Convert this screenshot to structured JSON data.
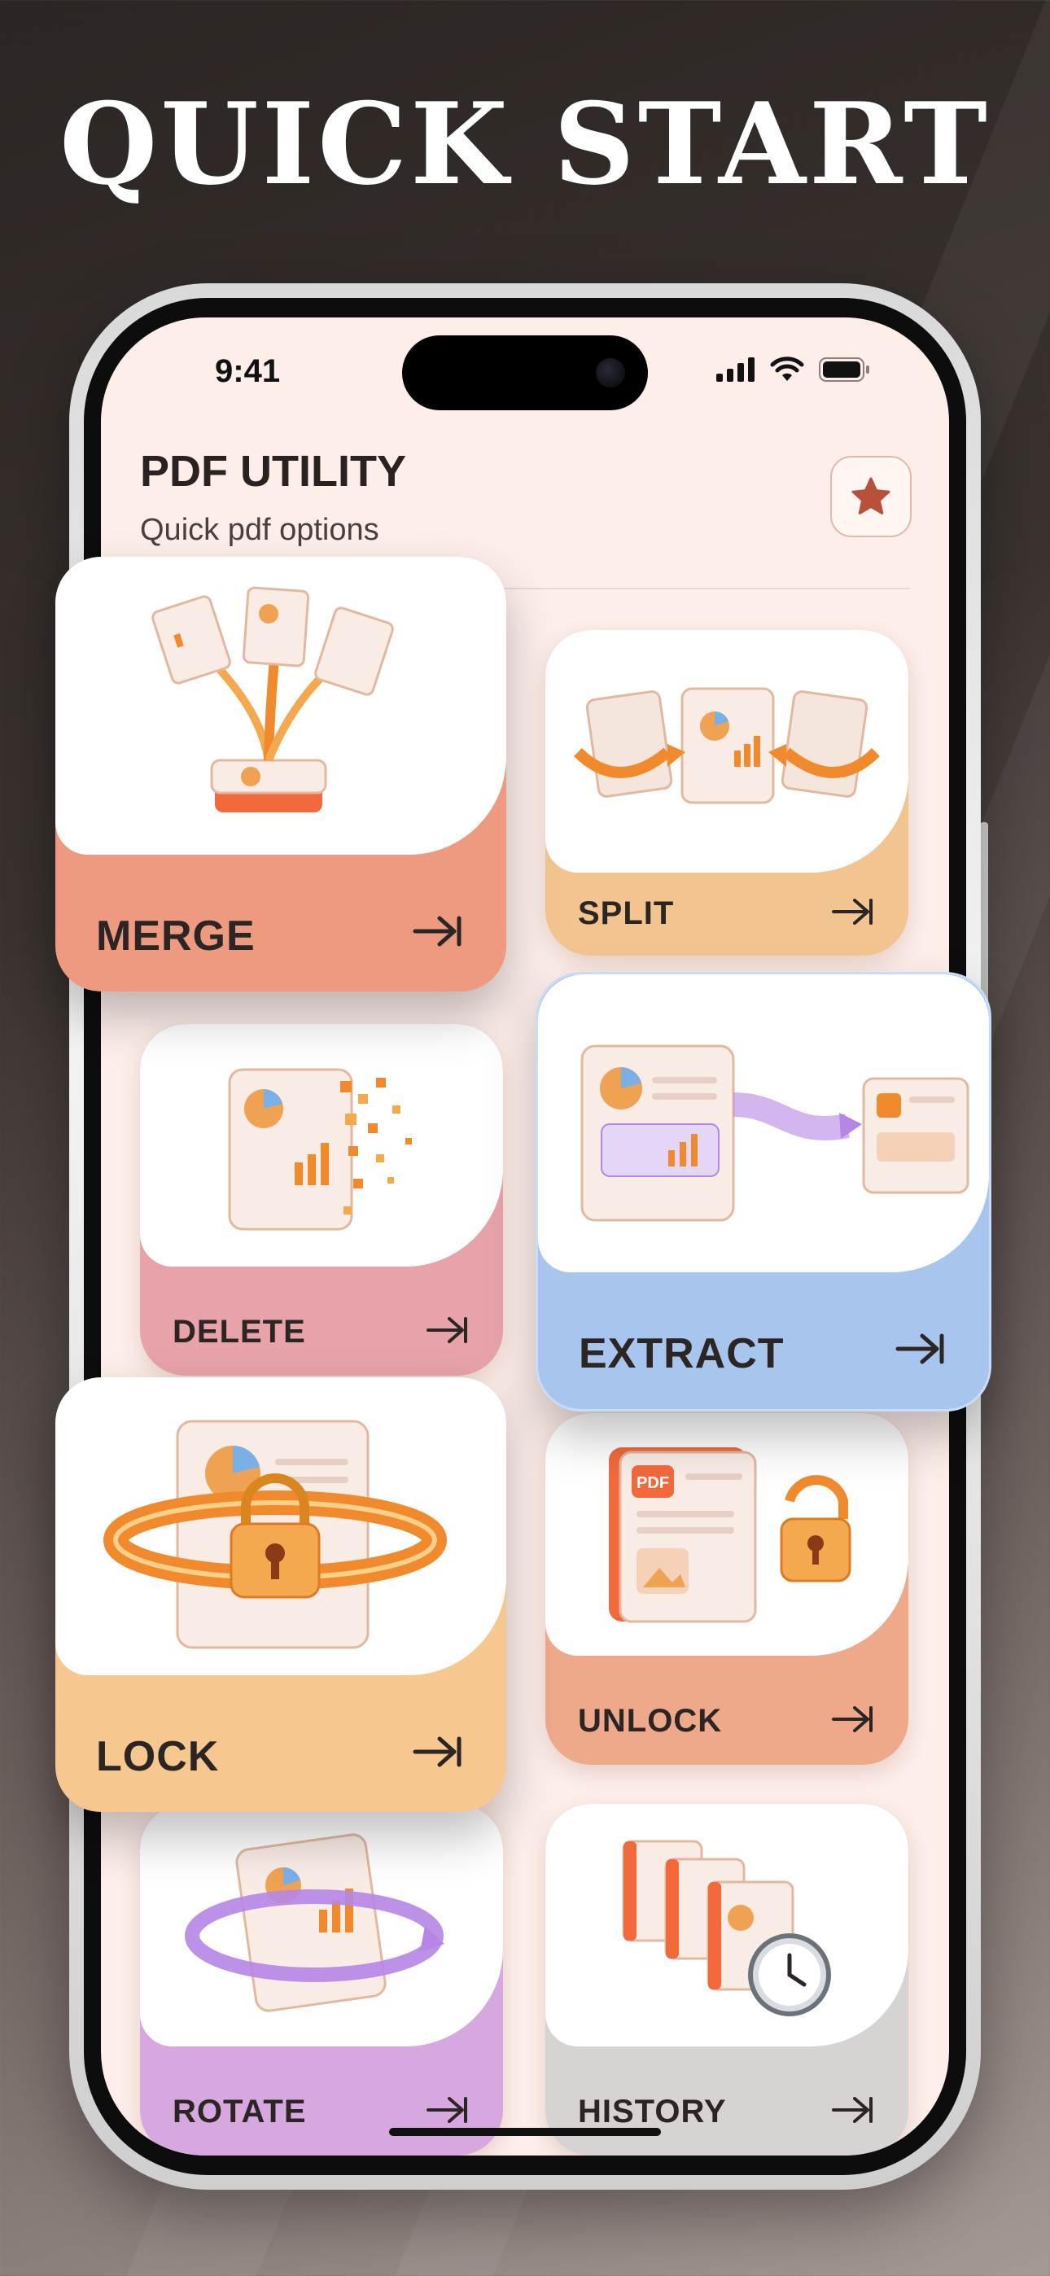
{
  "headline": "QUICK START",
  "status_bar": {
    "time": "9:41"
  },
  "header": {
    "title": "PDF UTILITY",
    "subtitle": "Quick pdf options"
  },
  "icons": {
    "favorite": "star-icon",
    "card_arrow": "arrow-right-icon",
    "signal": "cellular-signal-icon",
    "wifi": "wifi-icon",
    "battery": "battery-icon"
  },
  "art_badges": {
    "pdf": "PDF"
  },
  "cards": [
    {
      "id": "merge",
      "label": "MERGE",
      "color": "#ee9a80"
    },
    {
      "id": "split",
      "label": "SPLIT",
      "color": "#f2c48f"
    },
    {
      "id": "delete",
      "label": "DELETE",
      "color": "#e7a2aa"
    },
    {
      "id": "extract",
      "label": "EXTRACT",
      "color": "#a8c5ee"
    },
    {
      "id": "lock",
      "label": "LOCK",
      "color": "#f6c88f"
    },
    {
      "id": "unlock",
      "label": "UNLOCK",
      "color": "#eea98a"
    },
    {
      "id": "rotate",
      "label": "ROTATE",
      "color": "#d7a8df"
    },
    {
      "id": "history",
      "label": "HISTORY",
      "color": "#d6d3d2"
    }
  ],
  "colors": {
    "screen_bg": "#fdeee9",
    "title_text": "#2a2220",
    "accent_star": "#b8503a",
    "art_orange": "#f08a2c",
    "art_purple": "#b586e6"
  }
}
